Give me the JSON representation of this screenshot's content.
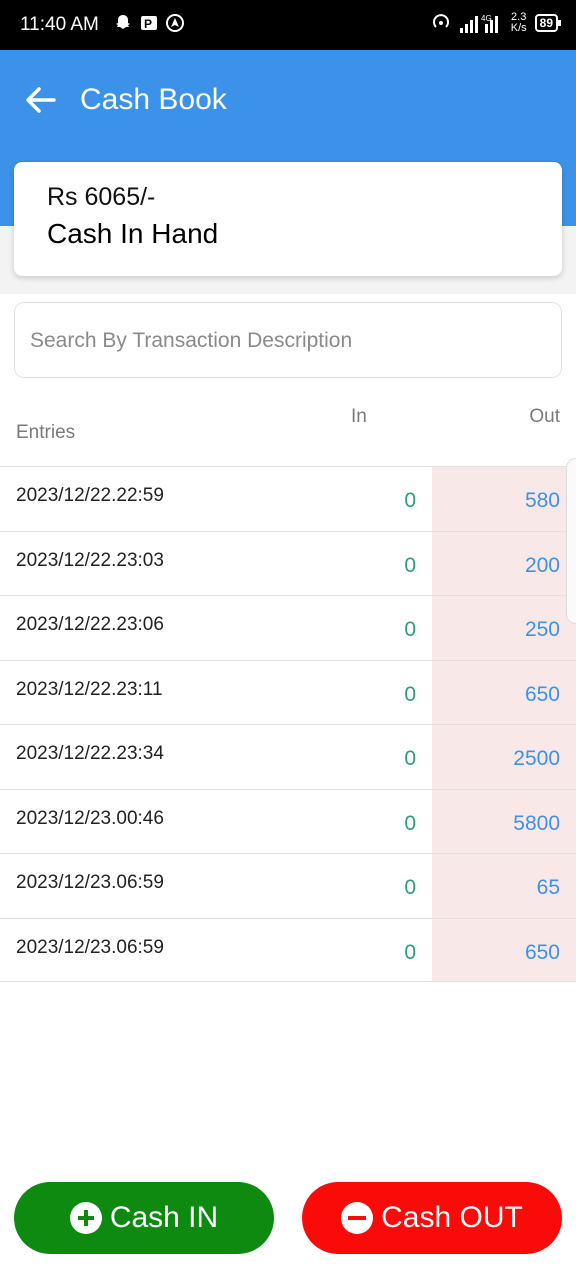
{
  "status_bar": {
    "time": "11:40 AM",
    "speed_top": "2.3",
    "speed_bottom": "K/s",
    "network": "4G",
    "battery": "89"
  },
  "app_bar": {
    "title": "Cash Book",
    "color": "#3c92e8"
  },
  "summary": {
    "amount": "Rs 6065/-",
    "label": "Cash In Hand"
  },
  "search": {
    "placeholder": "Search By Transaction Description",
    "value": ""
  },
  "table": {
    "headers": {
      "entries": "Entries",
      "in": "In",
      "out": "Out"
    },
    "rows": [
      {
        "date": "2023/12/22.22:59",
        "in": "0",
        "out": "580"
      },
      {
        "date": "2023/12/22.23:03",
        "in": "0",
        "out": "200"
      },
      {
        "date": "2023/12/22.23:06",
        "in": "0",
        "out": "250"
      },
      {
        "date": "2023/12/22.23:11",
        "in": "0",
        "out": "650"
      },
      {
        "date": "2023/12/22.23:34",
        "in": "0",
        "out": "2500"
      },
      {
        "date": "2023/12/23.00:46",
        "in": "0",
        "out": "5800"
      },
      {
        "date": "2023/12/23.06:59",
        "in": "0",
        "out": "65"
      },
      {
        "date": "2023/12/23.06:59",
        "in": "0",
        "out": "650"
      }
    ]
  },
  "actions": {
    "cash_in_label": "Cash IN",
    "cash_out_label": "Cash OUT",
    "cash_in_color": "#0e8a10",
    "cash_out_color": "#fb0a0a"
  },
  "icons": {
    "back": "arrow-left-icon",
    "plus": "plus-circle-icon",
    "minus": "minus-circle-icon"
  }
}
